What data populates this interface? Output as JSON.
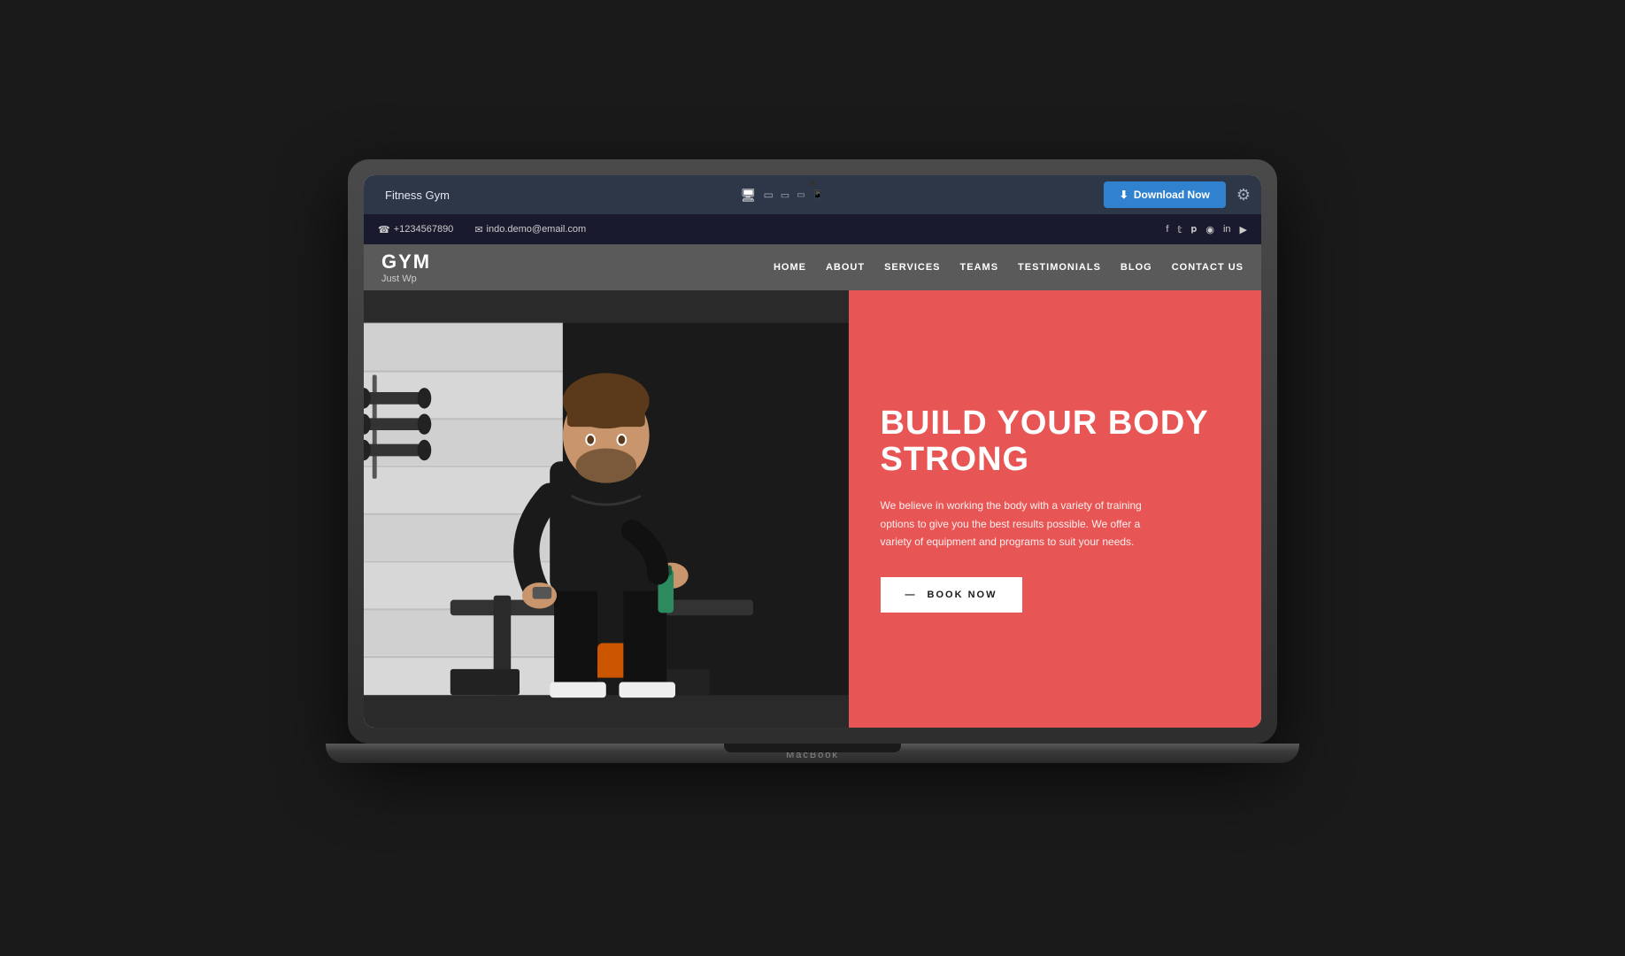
{
  "toolbar": {
    "site_name": "Fitness Gym",
    "download_label": "Download Now",
    "download_icon": "⬇",
    "settings_icon": "⚙"
  },
  "devices": [
    {
      "label": "desktop",
      "icon": "🖥",
      "active": true
    },
    {
      "label": "monitor",
      "icon": "▭",
      "active": false
    },
    {
      "label": "tablet",
      "icon": "▭",
      "active": false
    },
    {
      "label": "tablet-sm",
      "icon": "▭",
      "active": false
    },
    {
      "label": "phone",
      "icon": "📱",
      "active": false
    }
  ],
  "contact_bar": {
    "phone": "+1234567890",
    "email": "indo.demo@email.com",
    "phone_icon": "☎",
    "email_icon": "✉"
  },
  "social": {
    "icons": [
      "f",
      "t",
      "p",
      "📷",
      "in",
      "▶"
    ]
  },
  "nav": {
    "logo": "GYM",
    "tagline": "Just Wp",
    "links": [
      "HOME",
      "ABOUT",
      "SERVICES",
      "TEAMS",
      "TESTIMONIALS",
      "BLOG",
      "CONTACT US"
    ]
  },
  "hero": {
    "title_line1": "BUILD YOUR BODY",
    "title_line2": "STRONG",
    "description": "We believe in working the body with a variety of training options to give you the best results possible. We offer a variety of equipment and programs to suit your needs.",
    "cta_label": "BOOK NOW",
    "cta_arrow": "—",
    "bg_color": "#e85555"
  },
  "macbook": {
    "brand": "MacBook"
  }
}
